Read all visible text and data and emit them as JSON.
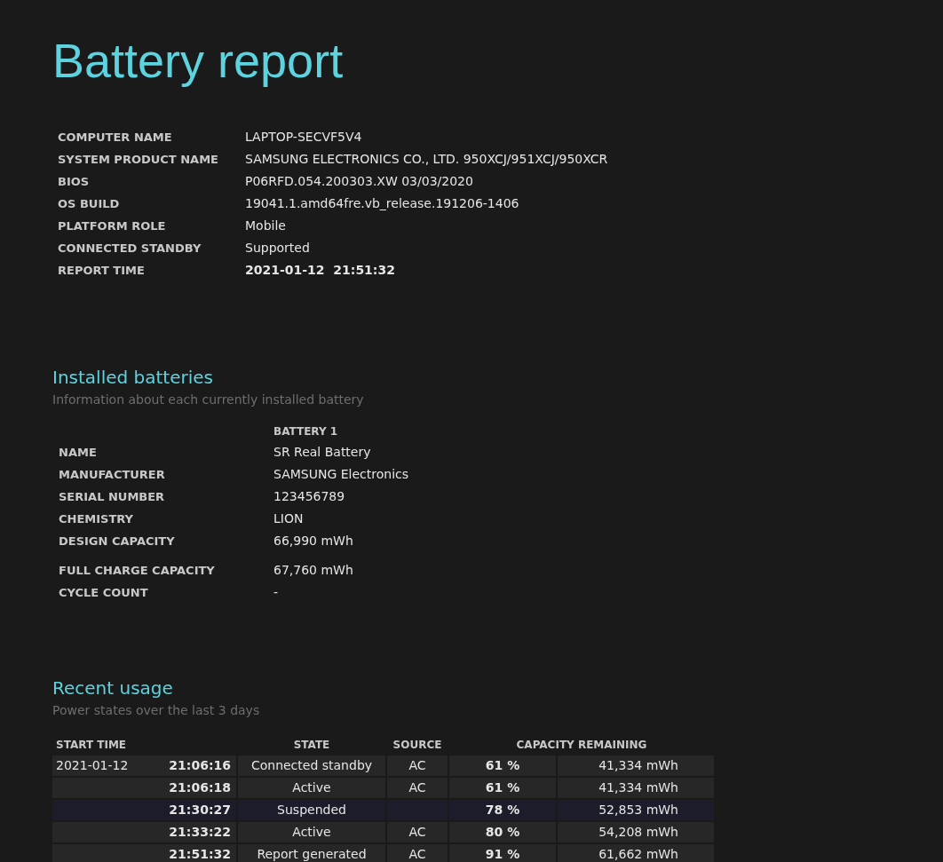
{
  "title": "Battery report",
  "system_info": [
    {
      "label": "COMPUTER NAME",
      "value": "LAPTOP-SECVF5V4",
      "emphasis": false
    },
    {
      "label": "SYSTEM PRODUCT NAME",
      "value": "SAMSUNG ELECTRONICS CO., LTD. 950XCJ/951XCJ/950XCR",
      "emphasis": false
    },
    {
      "label": "BIOS",
      "value": "P06RFD.054.200303.XW 03/03/2020",
      "emphasis": false
    },
    {
      "label": "OS BUILD",
      "value": "19041.1.amd64fre.vb_release.191206-1406",
      "emphasis": false
    },
    {
      "label": "PLATFORM ROLE",
      "value": "Mobile",
      "emphasis": false
    },
    {
      "label": "CONNECTED STANDBY",
      "value": "Supported",
      "emphasis": false
    },
    {
      "label": "REPORT TIME",
      "value": "2021-01-12  21:51:32",
      "emphasis": true
    }
  ],
  "installed_batteries": {
    "heading": "Installed batteries",
    "subtitle": "Information about each currently installed battery",
    "column": "BATTERY 1",
    "rows": [
      {
        "label": "NAME",
        "value": "SR Real Battery"
      },
      {
        "label": "MANUFACTURER",
        "value": "SAMSUNG Electronics"
      },
      {
        "label": "SERIAL NUMBER",
        "value": "123456789"
      },
      {
        "label": "CHEMISTRY",
        "value": "LION"
      },
      {
        "label": "DESIGN CAPACITY",
        "value": "66,990 mWh"
      }
    ],
    "capacity_rows": [
      {
        "label": "FULL CHARGE CAPACITY",
        "value": "67,760 mWh"
      },
      {
        "label": "CYCLE COUNT",
        "value": "-"
      }
    ]
  },
  "recent_usage": {
    "heading": "Recent usage",
    "subtitle": "Power states over the last 3 days",
    "columns": [
      "START TIME",
      "STATE",
      "SOURCE",
      "CAPACITY REMAINING"
    ],
    "rows": [
      {
        "kind": "normal",
        "date": "2021-01-12",
        "time": "21:06:16",
        "state": "Connected standby",
        "source": "AC",
        "percent": "61 %",
        "energy": "41,334 mWh"
      },
      {
        "kind": "normal",
        "time": "21:06:18",
        "state": "Active",
        "source": "AC",
        "percent": "61 %",
        "energy": "41,334 mWh"
      },
      {
        "kind": "suspended",
        "time": "21:30:27",
        "state": "Suspended",
        "percent": "78 %",
        "energy": "52,853 mWh"
      },
      {
        "kind": "normal",
        "time": "21:33:22",
        "state": "Active",
        "source": "AC",
        "percent": "80 %",
        "energy": "54,208 mWh"
      },
      {
        "kind": "normal",
        "time": "21:51:32",
        "state": "Report generated",
        "source": "AC",
        "percent": "91 %",
        "energy": "61,662 mWh"
      }
    ]
  }
}
